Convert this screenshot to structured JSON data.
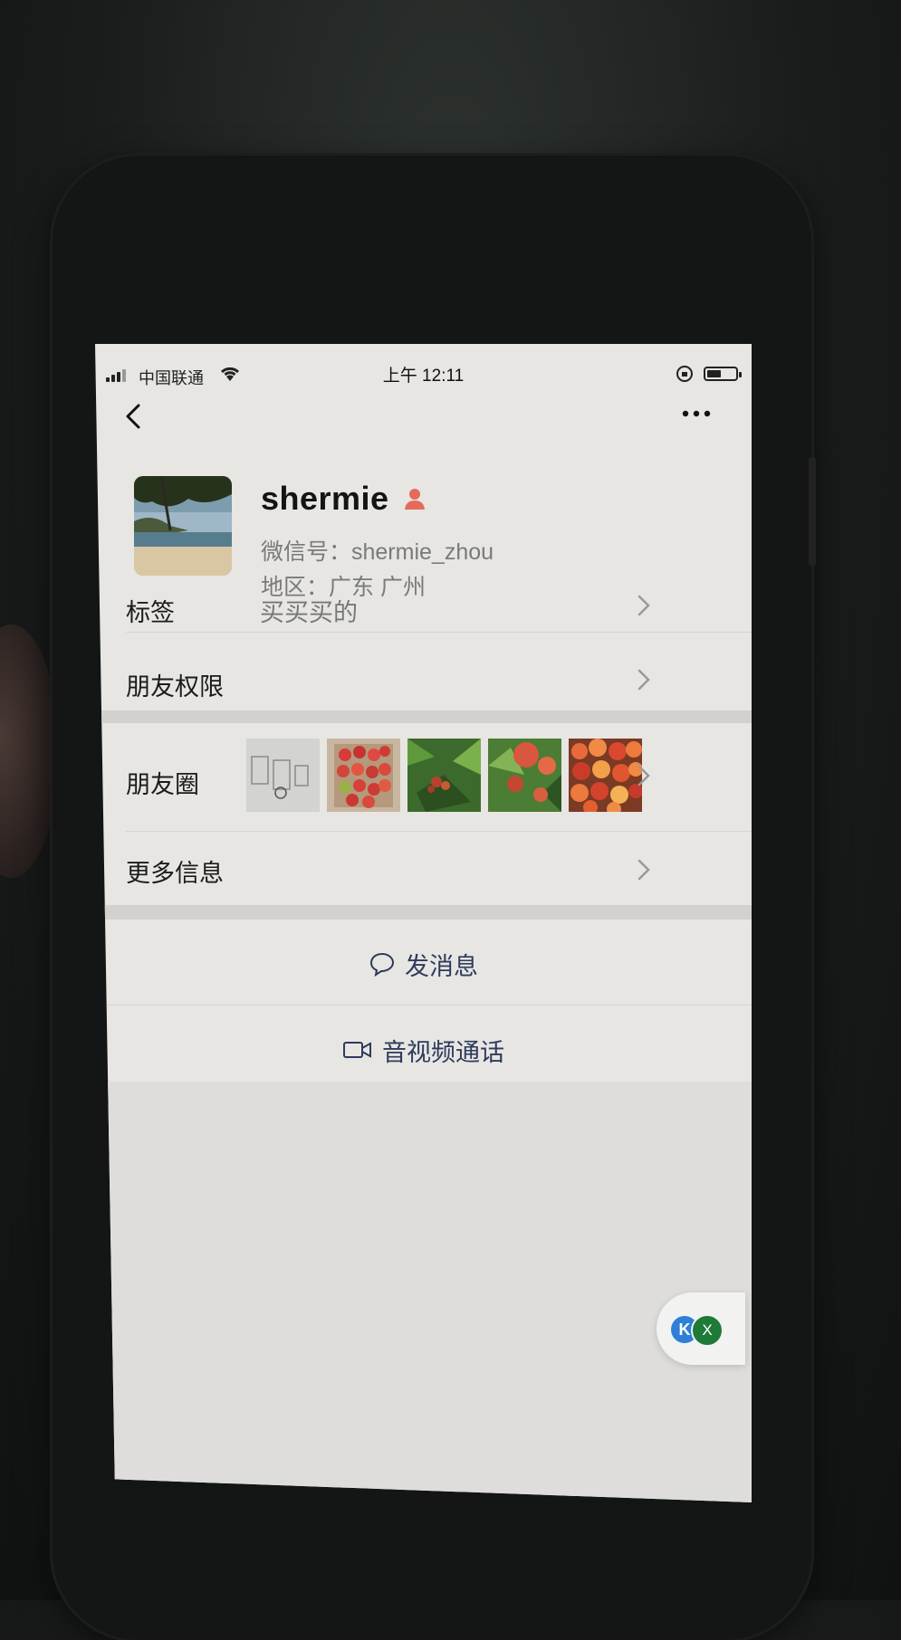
{
  "status_bar": {
    "carrier": "中国联通",
    "time": "上午 12:11"
  },
  "profile": {
    "name": "shermie",
    "wechat_id": "微信号：shermie_zhou",
    "region": "地区：广东 广州"
  },
  "rows": {
    "tags": {
      "label": "标签",
      "value": "买买买的"
    },
    "permissions": {
      "label": "朋友权限"
    },
    "moments": {
      "label": "朋友圈"
    },
    "more_info": {
      "label": "更多信息"
    }
  },
  "actions": {
    "send_message": "发消息",
    "av_call": "音视频通话"
  },
  "floating_widget": {
    "k_label": "K",
    "x_label": "X"
  },
  "colors": {
    "accent_text": "#2f3a5c",
    "gender_icon": "#e46b5c"
  },
  "icons": {
    "back": "chevron-left-icon",
    "more": "more-dots-icon",
    "chat": "chat-bubble-icon",
    "video": "video-camera-icon",
    "gender": "person-female-icon"
  }
}
